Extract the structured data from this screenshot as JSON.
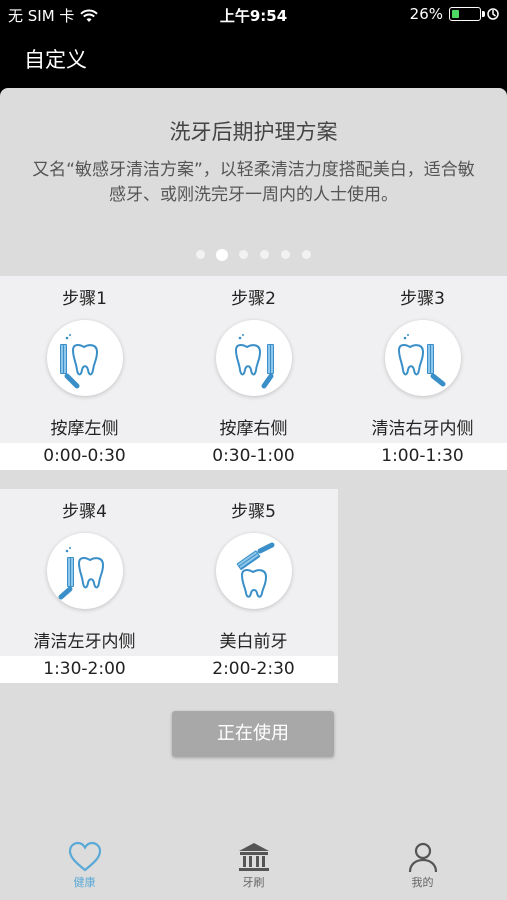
{
  "status_bar": {
    "carrier": "无 SIM 卡",
    "time": "上午9:54",
    "battery": "26%",
    "battery_level": 0.26
  },
  "nav": {
    "title": "自定义"
  },
  "plan": {
    "title": "洗牙后期护理方案",
    "description": "又名“敏感牙清洁方案”，以轻柔清洁力度搭配美白，适合敏感牙、或刚洗完牙一周内的人士使用。",
    "page_count": 6,
    "active_page": 2
  },
  "steps": [
    {
      "title": "步骤1",
      "name": "按摩左侧",
      "time": "0:00-0:30",
      "icon": "brush-left-tooth-icon"
    },
    {
      "title": "步骤2",
      "name": "按摩右侧",
      "time": "0:30-1:00",
      "icon": "brush-right-tooth-icon"
    },
    {
      "title": "步骤3",
      "name": "清洁右牙内侧",
      "time": "1:00-1:30",
      "icon": "brush-right-inner-tooth-icon"
    },
    {
      "title": "步骤4",
      "name": "清洁左牙内侧",
      "time": "1:30-2:00",
      "icon": "brush-left-inner-tooth-icon"
    },
    {
      "title": "步骤5",
      "name": "美白前牙",
      "time": "2:00-2:30",
      "icon": "brush-front-tooth-icon"
    }
  ],
  "action": {
    "label": "正在使用"
  },
  "tabs": [
    {
      "label": "健康",
      "icon": "heart-icon",
      "active": true
    },
    {
      "label": "牙刷",
      "icon": "toothbrush-bank-icon",
      "active": false
    },
    {
      "label": "我的",
      "icon": "person-icon",
      "active": false
    }
  ],
  "colors": {
    "accent": "#5aa9d6",
    "icon_blue": "#3a8fc8",
    "button_gray": "#a8a8a8"
  }
}
